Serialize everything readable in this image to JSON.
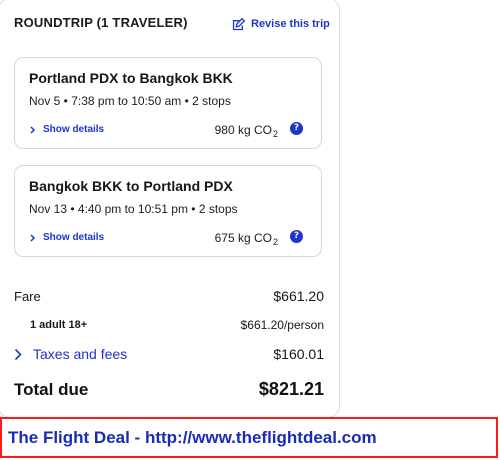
{
  "header": {
    "title": "ROUNDTRIP (1 TRAVELER)",
    "revise_label": "Revise this trip",
    "revise_icon": "edit-icon"
  },
  "trips": [
    {
      "route": "Portland PDX to Bangkok BKK",
      "times": "Nov 5 • 7:38 pm to 10:50 am • 2 stops",
      "show_details_label": "Show details",
      "co2_value": "980 kg CO",
      "co2_subscript": "2",
      "help_glyph": "?"
    },
    {
      "route": "Bangkok BKK to Portland PDX",
      "times": "Nov 13 • 4:40 pm to 10:51 pm • 2 stops",
      "show_details_label": "Show details",
      "co2_value": "675 kg CO",
      "co2_subscript": "2",
      "help_glyph": "?"
    }
  ],
  "summary": {
    "fare_label": "Fare",
    "fare_amount": "$661.20",
    "traveler_label": "1 adult 18+",
    "traveler_amount": "$661.20/person",
    "taxes_label": "Taxes and fees",
    "taxes_amount": "$160.01",
    "total_label": "Total due",
    "total_amount": "$821.21"
  },
  "banner": {
    "text": "The Flight Deal - http://www.theflightdeal.com"
  },
  "colors": {
    "accent": "#1f35c9",
    "banner_border": "#ff1a1a",
    "banner_text": "#1a2bb6"
  }
}
